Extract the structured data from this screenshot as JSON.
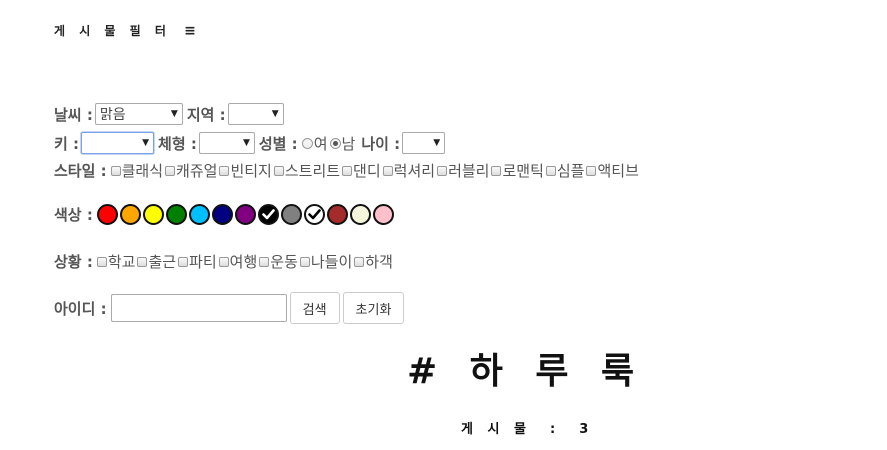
{
  "header": {
    "title": "게 시 물  필 터",
    "menu_icon": "≡"
  },
  "filters": {
    "weather": {
      "label": "날씨 :",
      "selected": "맑음"
    },
    "region": {
      "label": "지역 :",
      "selected": ""
    },
    "height": {
      "label": "키 :",
      "selected": ""
    },
    "body_type": {
      "label": "체형 :",
      "selected": ""
    },
    "gender": {
      "label": "성별 :",
      "options": [
        "여",
        "남"
      ],
      "selected": "남"
    },
    "age": {
      "label": "나이 :",
      "selected": ""
    },
    "style": {
      "label": "스타일 :",
      "options": [
        "클래식",
        "캐쥬얼",
        "빈티지",
        "스트리트",
        "댄디",
        "럭셔리",
        "러블리",
        "로맨틱",
        "심플",
        "액티브"
      ]
    },
    "color": {
      "label": "색상 :",
      "swatches": [
        {
          "color": "#ff0000",
          "checked": false
        },
        {
          "color": "#ffa500",
          "checked": false
        },
        {
          "color": "#ffff00",
          "checked": false
        },
        {
          "color": "#008000",
          "checked": false
        },
        {
          "color": "#00bfff",
          "checked": false
        },
        {
          "color": "#000080",
          "checked": false
        },
        {
          "color": "#800080",
          "checked": false
        },
        {
          "color": "#000000",
          "checked": true
        },
        {
          "color": "#808080",
          "checked": false
        },
        {
          "color": "#ffffff",
          "checked": true
        },
        {
          "color": "#a52a2a",
          "checked": false
        },
        {
          "color": "#f5f5dc",
          "checked": false
        },
        {
          "color": "#ffc0cb",
          "checked": false
        }
      ]
    },
    "situation": {
      "label": "상황 :",
      "options": [
        "학교",
        "출근",
        "파티",
        "여행",
        "운동",
        "나들이",
        "하객"
      ]
    },
    "user_id": {
      "label": "아이디 :",
      "value": "",
      "placeholder": ""
    }
  },
  "buttons": {
    "search": "검색",
    "reset": "초기화"
  },
  "brand": "# 하 루 룩",
  "post_count": {
    "label": "게 시 물  :  3"
  }
}
